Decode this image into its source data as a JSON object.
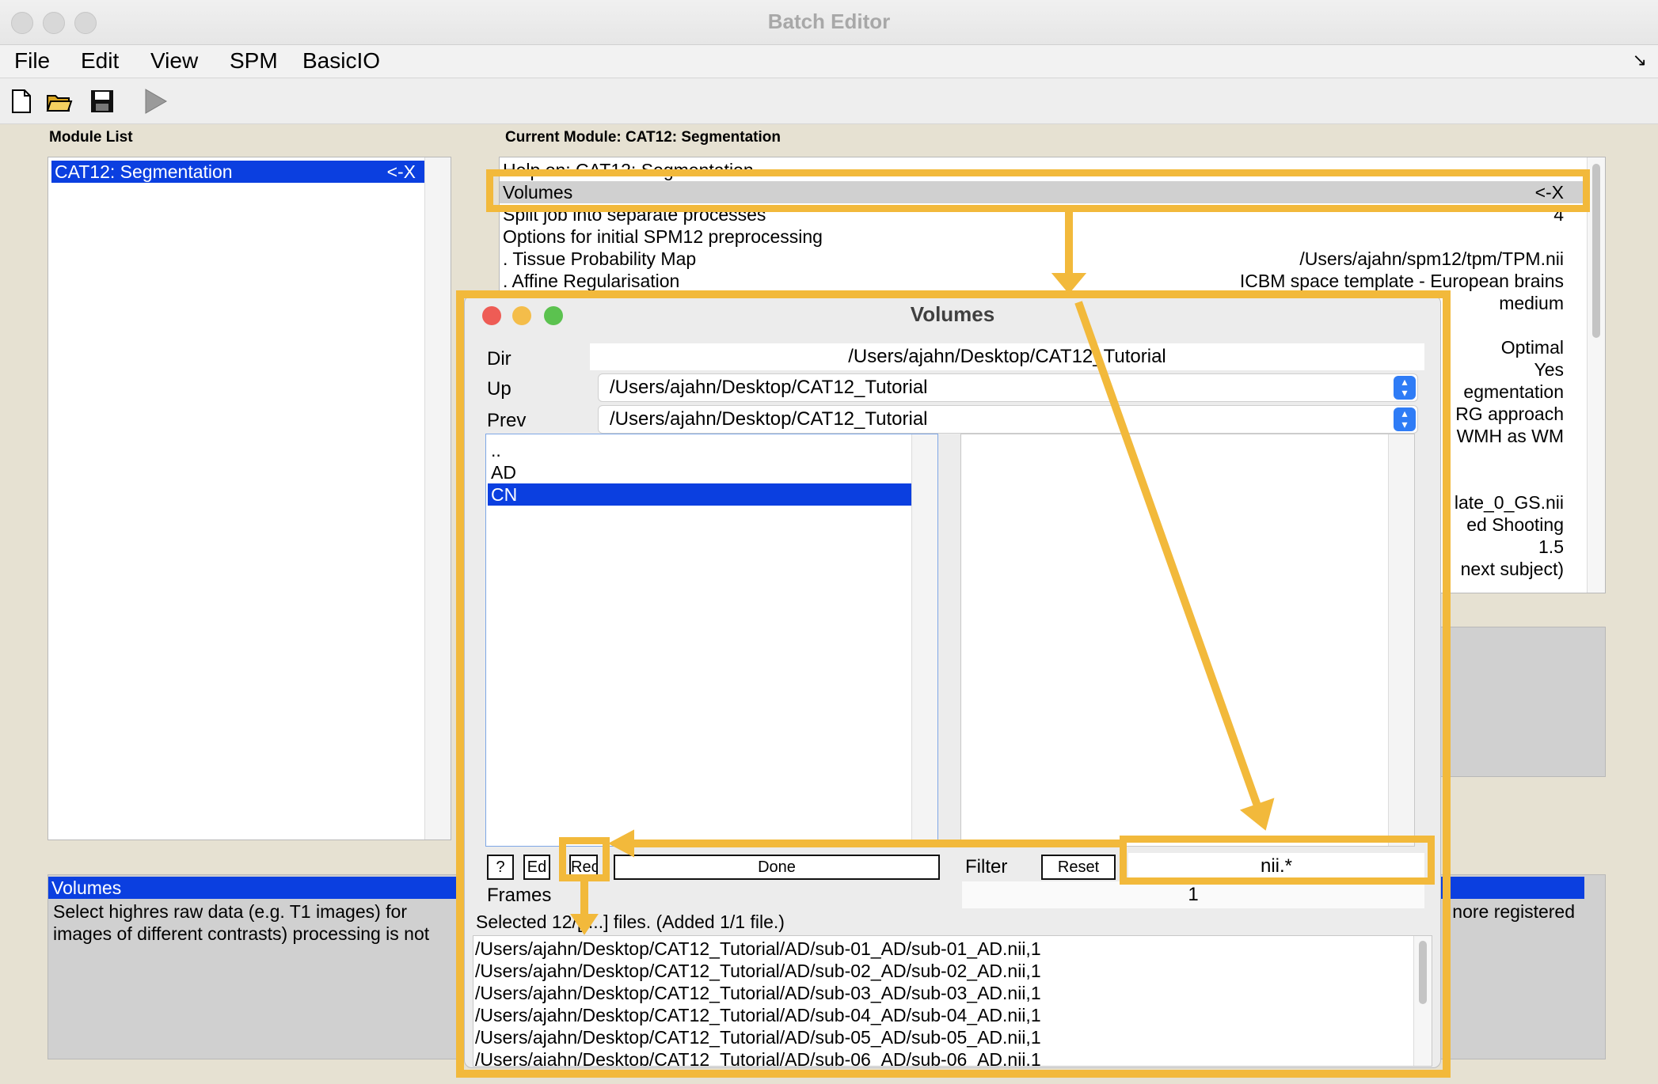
{
  "window": {
    "title": "Batch Editor"
  },
  "menu": {
    "items": [
      "File",
      "Edit",
      "View",
      "SPM",
      "BasicIO"
    ],
    "corner_glyph": "↘"
  },
  "toolbar": {
    "icons": [
      "new-file-icon",
      "open-folder-icon",
      "save-icon",
      "run-icon"
    ]
  },
  "module_list": {
    "label": "Module List",
    "items": [
      {
        "label": "CAT12: Segmentation",
        "action": "<-X"
      }
    ]
  },
  "current_module": {
    "label": "Current Module: CAT12: Segmentation",
    "rows": [
      {
        "label": "Help on: CAT12: Segmentation",
        "value": ""
      },
      {
        "label": "Volumes",
        "value": "<-X"
      },
      {
        "label": "Split job into separate processes",
        "value": "4"
      },
      {
        "label": "Options for initial SPM12 preprocessing",
        "value": ""
      },
      {
        "label": ". Tissue Probability Map",
        "value": "/Users/ajahn/spm12/tpm/TPM.nii"
      },
      {
        "label": ". Affine Regularisation",
        "value": "ICBM space template - European brains"
      },
      {
        "label": "",
        "value": "medium"
      },
      {
        "label": "",
        "value": ""
      },
      {
        "label": "",
        "value": "Optimal"
      },
      {
        "label": "",
        "value": "Yes"
      },
      {
        "label": "",
        "value": "egmentation"
      },
      {
        "label": "",
        "value": "RG approach"
      },
      {
        "label": "",
        "value": "WMH as WM"
      },
      {
        "label": "",
        "value": ""
      },
      {
        "label": "",
        "value": "late_0_GS.nii"
      },
      {
        "label": "",
        "value": "ed Shooting"
      },
      {
        "label": "",
        "value": "1.5"
      },
      {
        "label": "",
        "value": "next subject)"
      }
    ]
  },
  "help_panel": {
    "title": "Volumes",
    "text_line1_left": "Select highres raw data (e.g. T1 images) for",
    "text_line1_right": "nore registered",
    "text_line2_left": "images of different contrasts) processing is not"
  },
  "dialog": {
    "title": "Volumes",
    "dir_label": "Dir",
    "dir_value": "/Users/ajahn/Desktop/CAT12_Tutorial",
    "up_label": "Up",
    "up_value": "/Users/ajahn/Desktop/CAT12_Tutorial",
    "prev_label": "Prev",
    "prev_value": "/Users/ajahn/Desktop/CAT12_Tutorial",
    "dirs": [
      "..",
      "AD",
      "CN"
    ],
    "selected_dir": "CN",
    "buttons": {
      "help": "?",
      "ed": "Ed",
      "rec": "Rec",
      "done": "Done",
      "reset": "Reset"
    },
    "filter_label": "Filter",
    "filter_value": "nii.*",
    "frames_label": "Frames",
    "frames_value": "1",
    "status": "Selected 12/[-...] files. (Added 1/1 file.)",
    "selected_files": [
      "/Users/ajahn/Desktop/CAT12_Tutorial/AD/sub-01_AD/sub-01_AD.nii,1",
      "/Users/ajahn/Desktop/CAT12_Tutorial/AD/sub-02_AD/sub-02_AD.nii,1",
      "/Users/ajahn/Desktop/CAT12_Tutorial/AD/sub-03_AD/sub-03_AD.nii,1",
      "/Users/ajahn/Desktop/CAT12_Tutorial/AD/sub-04_AD/sub-04_AD.nii,1",
      "/Users/ajahn/Desktop/CAT12_Tutorial/AD/sub-05_AD/sub-05_AD.nii,1",
      "/Users/ajahn/Desktop/CAT12_Tutorial/AD/sub-06_AD/sub-06_AD.nii,1"
    ]
  },
  "colors": {
    "highlight": "#f2b93b",
    "selection": "#0b3fe0",
    "background": "#e6e1d2"
  }
}
